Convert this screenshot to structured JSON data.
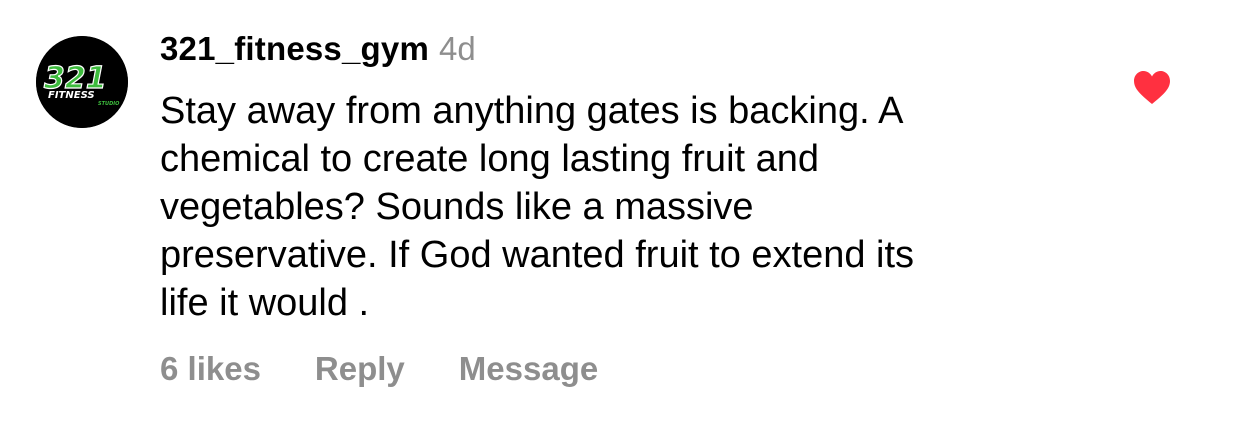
{
  "comment": {
    "avatar": {
      "icon": "gym-logo-icon",
      "logo_text": "321",
      "logo_subtext": "FITNESS",
      "logo_tiny": "STUDIO"
    },
    "username": "321_fitness_gym",
    "timestamp": "4d",
    "text": "Stay away from anything gates is backing. A\nchemical to create long lasting fruit and\nvegetables? Sounds like a massive\npreservative. If God wanted fruit to extend its\nlife it would .",
    "liked": true,
    "like_icon": "heart-icon",
    "actions": {
      "likes": "6 likes",
      "reply": "Reply",
      "message": "Message"
    }
  },
  "colors": {
    "like_red": "#ff3040",
    "muted_gray": "#8e8e8e",
    "logo_green": "#3dbb3d"
  }
}
